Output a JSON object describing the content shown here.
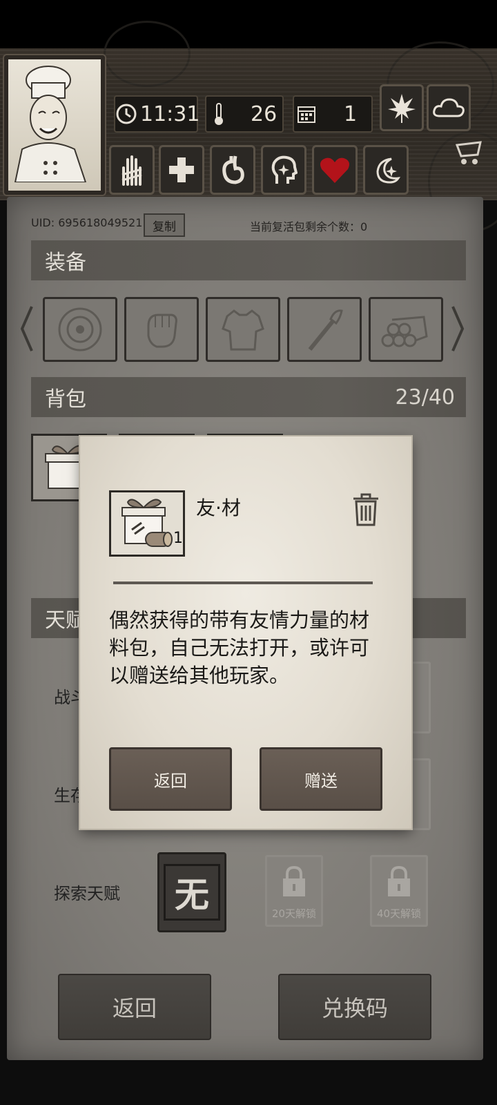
{
  "hud": {
    "time": "11:31",
    "temperature": "26",
    "day": "1"
  },
  "account": {
    "uid_label": "UID: 695618049521",
    "copy_label": "复制",
    "revive_label": "当前复活包剩余个数：0"
  },
  "sections": {
    "equipment": "装备",
    "backpack": "背包",
    "backpack_count": "23/40",
    "talent_partial": "天赋"
  },
  "talents": {
    "combat_partial": "战斗",
    "survival_partial": "生存",
    "explore_label": "探索天赋",
    "none_glyph": "无",
    "unlock_20": "20天解锁",
    "unlock_40": "40天解锁",
    "unlock_partial": "解锁"
  },
  "bottom": {
    "back_label": "返回",
    "redeem_label": "兑换码"
  },
  "dialog": {
    "item_name": "友·材",
    "item_count": "1",
    "description": "偶然获得的带有友情力量的材料包，自己无法打开，或许可以赠送给其他玩家。",
    "back_label": "返回",
    "gift_label": "赠送"
  },
  "colors": {
    "panel": "#7f7c77",
    "bar": "#5c5954",
    "dialog_paper": "#e6e0d4",
    "dialog_button": "#5f544c",
    "heart": "#b3131a"
  },
  "icons": {
    "clock": "clock-icon",
    "thermometer": "thermometer-icon",
    "calendar": "calendar-icon",
    "leaf": "leaf-icon",
    "cloud": "cloud-icon",
    "cart": "cart-icon",
    "trash": "trash-icon",
    "lock": "lock-icon"
  }
}
